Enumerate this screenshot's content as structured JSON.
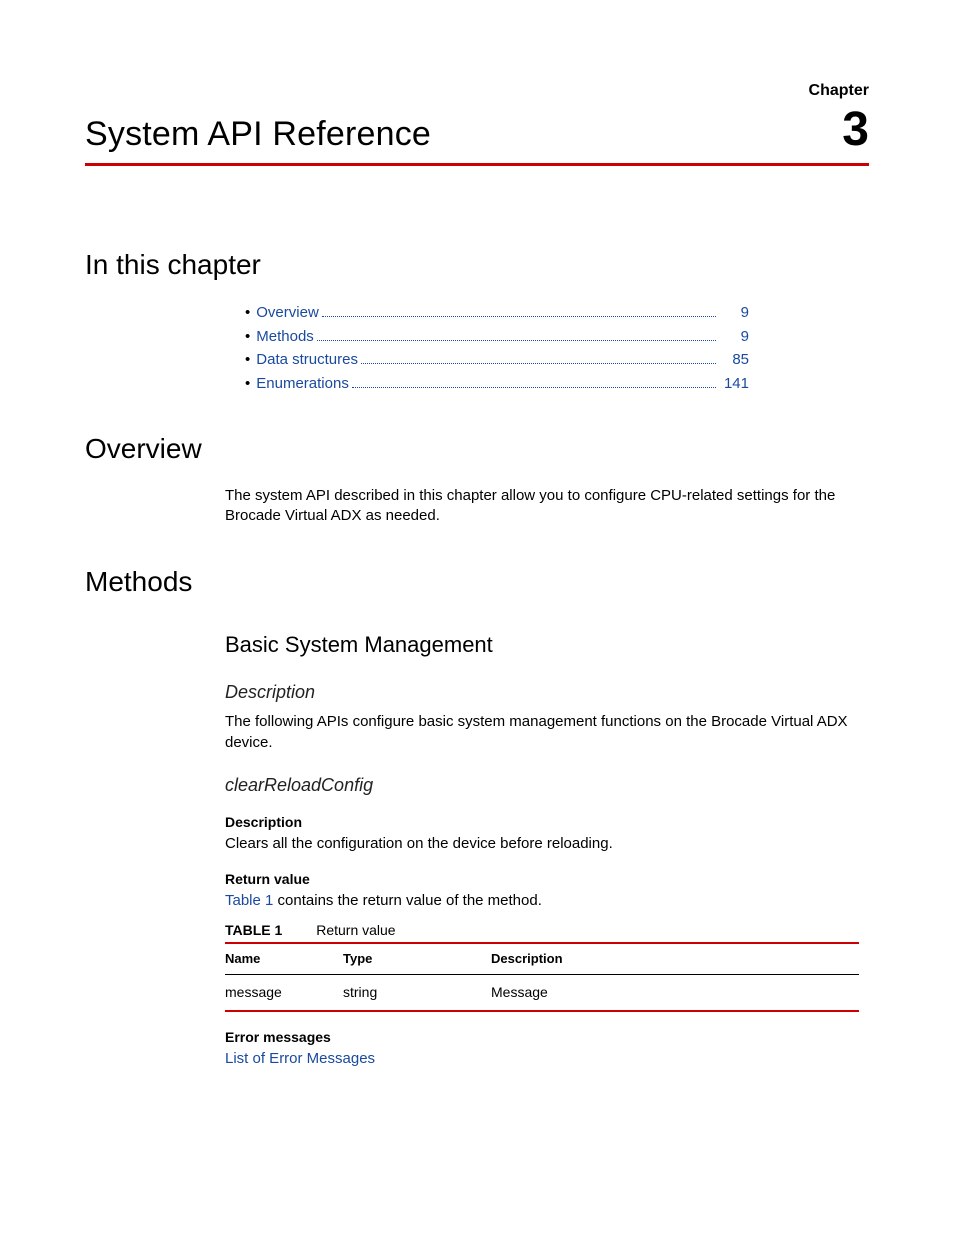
{
  "chapter_label": "Chapter",
  "chapter_number": "3",
  "page_title": "System API Reference",
  "sections": {
    "in_this_chapter": "In this chapter",
    "overview": "Overview",
    "methods": "Methods"
  },
  "toc": [
    {
      "label": "Overview",
      "page": "9"
    },
    {
      "label": "Methods",
      "page": "9"
    },
    {
      "label": "Data structures",
      "page": "85"
    },
    {
      "label": "Enumerations",
      "page": "141"
    }
  ],
  "overview_text": "The system API described in this chapter allow you to configure CPU-related settings for the Brocade Virtual ADX as needed.",
  "methods": {
    "sub_heading": "Basic System Management",
    "desc_head": "Description",
    "desc_text": "The following APIs configure basic system management functions on the Brocade Virtual ADX device.",
    "api_name": "clearReloadConfig",
    "api_desc_label": "Description",
    "api_desc_text": "Clears all the configuration on the device before reloading.",
    "retval_label": "Return value",
    "retval_sentence_link": "Table 1",
    "retval_sentence_rest": " contains the return value of the method.",
    "table_label": "TABLE 1",
    "table_caption": "Return value",
    "table": {
      "headers": {
        "name": "Name",
        "type": "Type",
        "desc": "Description"
      },
      "rows": [
        {
          "name": "message",
          "type": "string",
          "desc": "Message"
        }
      ]
    },
    "err_label": "Error messages",
    "err_link": "List of Error Messages"
  }
}
